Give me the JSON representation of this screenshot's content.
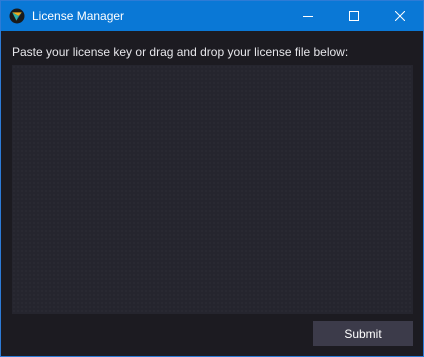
{
  "window": {
    "title": "License Manager",
    "icon": "app-logo-icon",
    "controls": {
      "minimize_icon": "minimize-icon",
      "maximize_icon": "maximize-icon",
      "close_icon": "close-icon"
    },
    "accent_color": "#0a78d6"
  },
  "form": {
    "prompt": "Paste your license key or drag and drop your license file below:",
    "license_value": "",
    "submit_label": "Submit"
  },
  "colors": {
    "background": "#1c1b21",
    "input_background": "#25252e",
    "button_background": "#3c3b4a",
    "text": "#e6e6ea"
  }
}
